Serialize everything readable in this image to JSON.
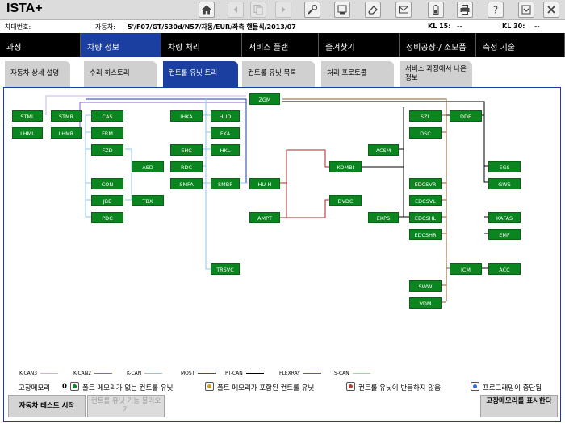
{
  "app": {
    "title": "ISTA+"
  },
  "toolbar": {
    "buttons": [
      {
        "name": "home-icon",
        "enabled": true
      },
      {
        "name": "back-icon",
        "enabled": false
      },
      {
        "name": "copy-icon",
        "enabled": false
      },
      {
        "name": "forward-icon",
        "enabled": false
      },
      {
        "name": "wrench-icon",
        "enabled": true
      },
      {
        "name": "connection-icon",
        "enabled": true
      },
      {
        "name": "eraser-icon",
        "enabled": true
      },
      {
        "name": "mail-icon",
        "enabled": true
      },
      {
        "name": "battery-icon",
        "enabled": true
      },
      {
        "name": "print-icon",
        "enabled": true
      },
      {
        "name": "help-icon",
        "enabled": true
      },
      {
        "name": "minimize-icon",
        "enabled": true
      },
      {
        "name": "close-icon",
        "enabled": true
      }
    ]
  },
  "vehicle": {
    "vin_label": "차대번호:",
    "car_label": "자동차:",
    "car_value": "5'/F07/GT/530d/N57/자동/EUR/좌측 핸들식/2013/07",
    "kl15_label": "KL 15:",
    "kl15_value": "--",
    "kl30_label": "KL 30:",
    "kl30_value": "--"
  },
  "nav": {
    "items": [
      {
        "label": "과정"
      },
      {
        "label": "차량 정보"
      },
      {
        "label": "차량 처리"
      },
      {
        "label": "서비스 플랜"
      },
      {
        "label": "즐겨찾기"
      },
      {
        "label": "정비공장-/ 소모품"
      },
      {
        "label": "측정 기술"
      }
    ],
    "active_index": 1
  },
  "subtabs": {
    "items": [
      {
        "label": "자동차 상세 설명"
      },
      {
        "label": "수리 히스토리"
      },
      {
        "label": "컨트롤 유닛 트리"
      },
      {
        "label": "컨트롤 유닛 목록"
      },
      {
        "label": "처리 프로토콜"
      },
      {
        "label": "서비스 과정에서 나온 정보"
      }
    ],
    "active_index": 2
  },
  "tree": {
    "units": [
      "ZGM",
      "STML",
      "STMR",
      "LHML",
      "LHMR",
      "CAS",
      "FRM",
      "FZD",
      "ASD",
      "CON",
      "JBE",
      "TBX",
      "PDC",
      "IHKA",
      "HUD",
      "FKA",
      "EHC",
      "HKL",
      "RDC",
      "SMFA",
      "SMBF",
      "TRSVC",
      "HU-H",
      "AMPT",
      "KOMBI",
      "DVDC",
      "ACSM",
      "EKPS",
      "SZL",
      "DSC",
      "DDE",
      "EGS",
      "GWS",
      "EDCSVR",
      "EDCSVL",
      "EDCSHL",
      "KAFAS",
      "EDCSHR",
      "EMF",
      "ICM",
      "ACC",
      "SWW",
      "VDM"
    ]
  },
  "legend": {
    "buses": [
      {
        "label": "K-CAN3",
        "color": "#c9b3ec"
      },
      {
        "label": "K-CAN2",
        "color": "#8a5fd1"
      },
      {
        "label": "K-CAN",
        "color": "#8fc4ea"
      },
      {
        "label": "MOST",
        "color": "#b22222"
      },
      {
        "label": "PT-CAN",
        "color": "#000000"
      },
      {
        "label": "FLEXRAY",
        "color": "#8b5a2b"
      },
      {
        "label": "S-CAN",
        "color": "#a3e06a"
      }
    ]
  },
  "status": {
    "fault_memory_label": "고장메모리",
    "fault_memory_count": "0",
    "no_fault": "폴트 메모리가 없는 컨트롤 유닛",
    "with_fault": "폴트 메모리가 포함된 컨트롤 유닛",
    "not_responding": "컨트롤 유닛이 반응하지 않음",
    "programming_aborted": "프로그래밍이 중단됨",
    "colors": {
      "ok": "#0b8520",
      "fault": "#d49a1a",
      "no_response": "#c0392b",
      "aborted": "#2f6fd6"
    }
  },
  "buttons": {
    "vehicle_test": "자동차 테스트 시작",
    "call_function": "컨트롤 유닛 기능 불러오기",
    "show_fault_memory": "고장메모리를 표시한다"
  }
}
